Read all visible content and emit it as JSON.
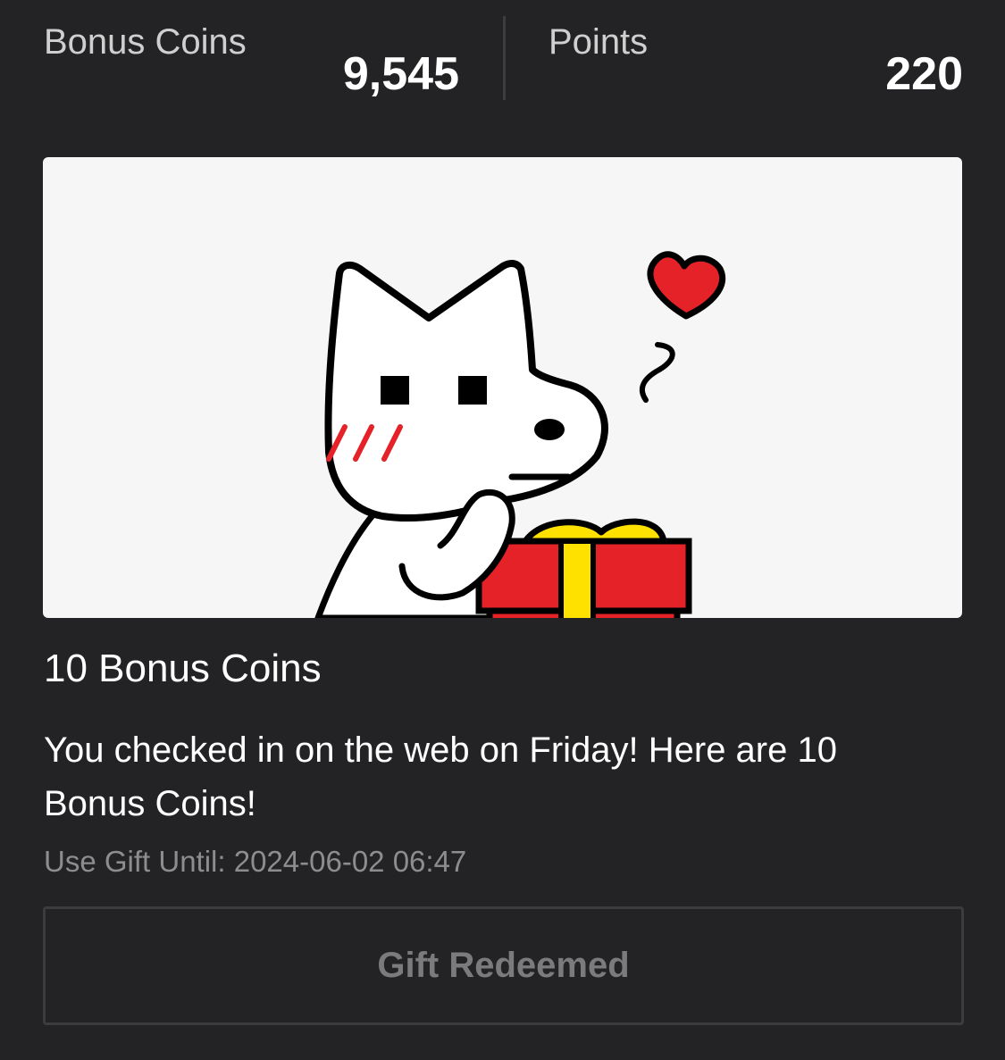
{
  "stats": {
    "bonus_coins_label": "Bonus Coins",
    "bonus_coins_value": "9,545",
    "points_label": "Points",
    "points_value": "220"
  },
  "banner": {
    "illustration": "cat-with-gift",
    "colors": {
      "background": "#f6f6f6",
      "gift_red": "#e42228",
      "ribbon_yellow": "#ffe100",
      "heart_red": "#e42228",
      "outline": "#000000"
    }
  },
  "gift": {
    "title": "10 Bonus Coins",
    "description": "You checked in on the web on Friday! Here are 10 Bonus Coins!",
    "expiry_label": "Use Gift Until:",
    "expiry_value": "2024-06-02 06:47"
  },
  "button": {
    "label": "Gift Redeemed",
    "state": "disabled"
  },
  "theme": {
    "background": "#232325",
    "text_primary": "#ffffff",
    "text_muted": "#8d8d90",
    "button_border": "#3c3c3f"
  }
}
